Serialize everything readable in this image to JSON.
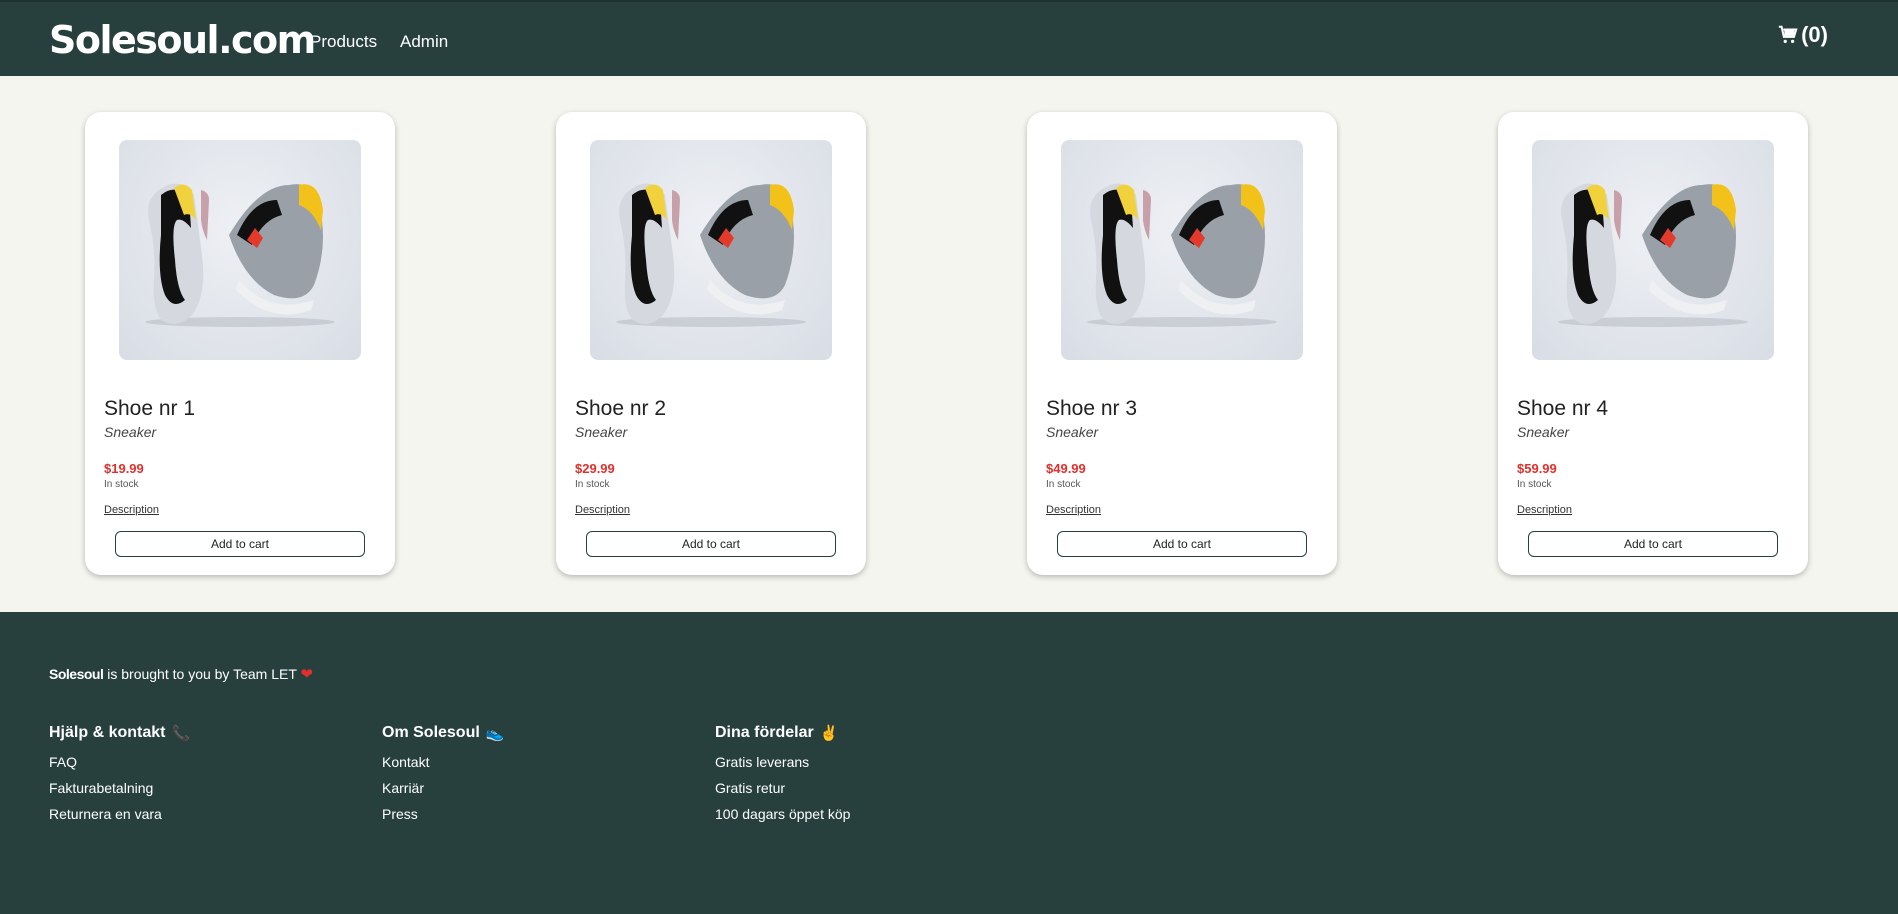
{
  "nav": {
    "logo": "Solesoul.com",
    "links": [
      "Products",
      "Admin"
    ],
    "cart_label": "(0)"
  },
  "products": [
    {
      "name": "Shoe nr 1",
      "type": "Sneaker",
      "price": "$19.99",
      "stock": "In stock",
      "description": "Description",
      "button": "Add to cart"
    },
    {
      "name": "Shoe nr 2",
      "type": "Sneaker",
      "price": "$29.99",
      "stock": "In stock",
      "description": "Description",
      "button": "Add to cart"
    },
    {
      "name": "Shoe nr 3",
      "type": "Sneaker",
      "price": "$49.99",
      "stock": "In stock",
      "description": "Description",
      "button": "Add to cart"
    },
    {
      "name": "Shoe nr 4",
      "type": "Sneaker",
      "price": "$59.99",
      "stock": "In stock",
      "description": "Description",
      "button": "Add to cart"
    }
  ],
  "footer": {
    "brand": "Solesoul",
    "tagline": "is brought to you by Team LET",
    "columns": [
      {
        "title": "Hjälp & kontakt",
        "icon": "📞",
        "links": [
          "FAQ",
          "Fakturabetalning",
          "Returnera en vara"
        ]
      },
      {
        "title": "Om Solesoul",
        "icon": "👟",
        "links": [
          "Kontakt",
          "Karriär",
          "Press"
        ]
      },
      {
        "title": "Dina fördelar",
        "icon": "✌",
        "links": [
          "Gratis leverans",
          "Gratis retur",
          "100 dagars öppet köp"
        ]
      }
    ]
  },
  "colors": {
    "header_bg": "#27403d",
    "price": "#e0302c",
    "page_bg": "#f5f5ef"
  }
}
